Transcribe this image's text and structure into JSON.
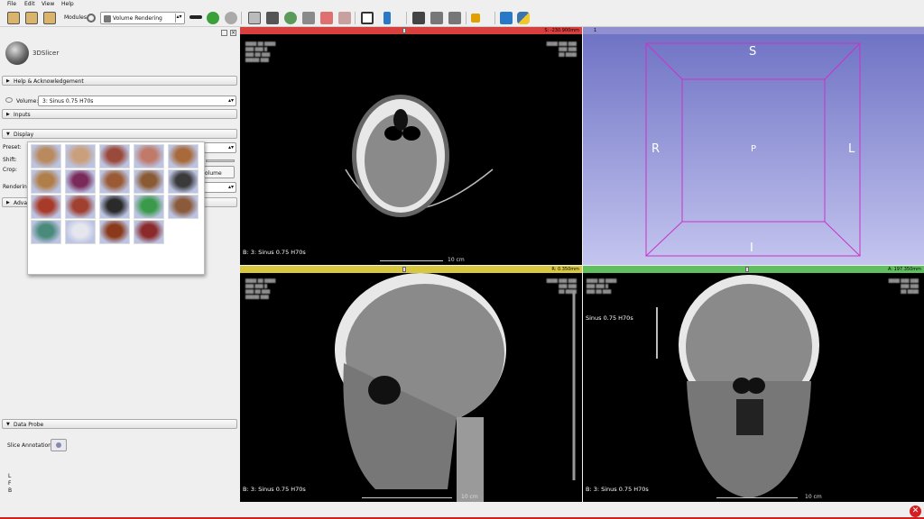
{
  "menu": [
    "File",
    "Edit",
    "View",
    "Help"
  ],
  "toolbar": {
    "modules_label": "Modules:",
    "module_selected": "Volume Rendering"
  },
  "panel": {
    "logo_text": "3DSlicer",
    "help_section": "Help & Acknowledgement",
    "volume_label": "Volume:",
    "volume_value": "3: Sinus  0.75  H70s",
    "inputs_section": "Inputs",
    "display_section": "Display",
    "preset_label": "Preset:",
    "shift_label": "Shift:",
    "crop_label": "Crop:",
    "crop_button": "olume",
    "rendering_label": "Rendering",
    "advanced_label": "Advanc",
    "data_probe_section": "Data Probe",
    "slice_annotations_label": "Slice Annotations:",
    "probe_lines": [
      "L",
      "F",
      "B"
    ]
  },
  "presets": {
    "count": 19,
    "colors": [
      "#b88a5e",
      "#caa07c",
      "#9a4a3a",
      "#c07a6a",
      "#a86a3a",
      "#b07e48",
      "#7a2a5a",
      "#9a5a34",
      "#8a5a34",
      "#3a3a3a",
      "#a83a2a",
      "#a04030",
      "#2a2a2a",
      "#3a9a4a",
      "#8a5a3a",
      "#4a8a7a",
      "#e6e6ee",
      "#8a3a1a",
      "#8a2a2a",
      "#2a6aaa",
      "#aab8d8",
      "#c8c0a0",
      "#b8c0dc",
      "#8ab85a"
    ]
  },
  "views": {
    "red": {
      "offset": "S: -230.900mm",
      "label": "B: 3: Sinus  0.75  H70s",
      "ruler": "10 cm"
    },
    "yellow": {
      "offset": "R: 0.350mm",
      "label": "B: 3: Sinus  0.75  H70s",
      "ruler": "10 cm"
    },
    "green": {
      "offset": "A: 197.350mm",
      "label": "B: 3: Sinus  0.75  H70s",
      "top_label": "Sinus  0.75  H70s",
      "ruler": "10 cm"
    },
    "threed": {
      "S": "S",
      "I": "I",
      "R": "R",
      "L": "L",
      "P": "P",
      "box_color": "#c832c8"
    }
  }
}
